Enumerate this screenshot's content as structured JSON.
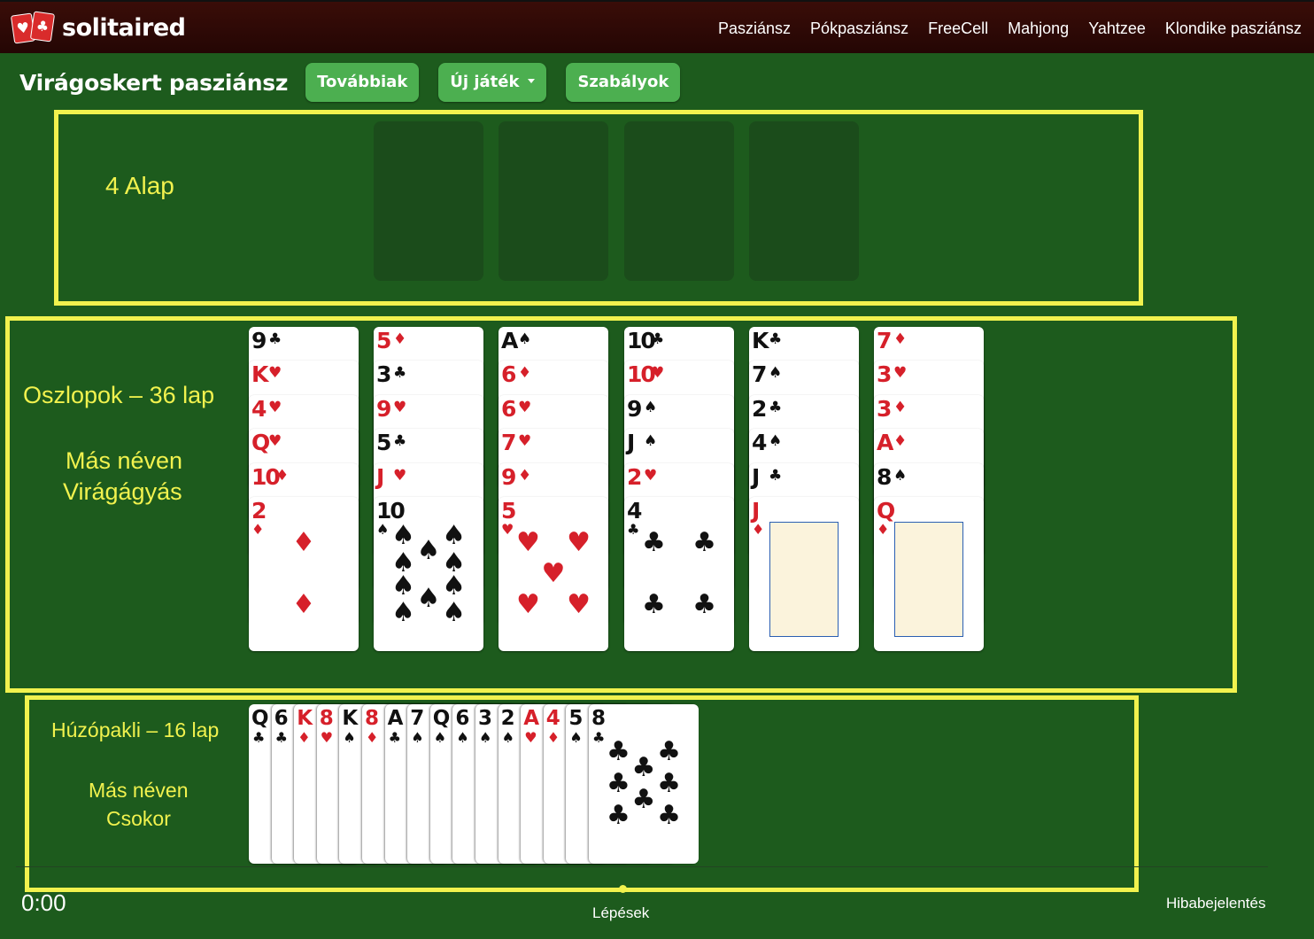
{
  "header": {
    "brand": "solitaired",
    "nav": [
      "Pasziánsz",
      "Pókpasziánsz",
      "FreeCell",
      "Mahjong",
      "Yahtzee",
      "Klondike pasziánsz"
    ]
  },
  "toolbar": {
    "title": "Virágoskert pasziánsz",
    "more_label": "Továbbiak",
    "new_game_label": "Új játék",
    "rules_label": "Szabályok"
  },
  "annotations": {
    "foundations": "4 Alap",
    "columns_title": "Oszlopok – 36 lap",
    "columns_alias_1": "Más néven",
    "columns_alias_2": "Virágágyás",
    "stock_title": "Húzópakli – 16 lap",
    "stock_alias_1": "Más néven",
    "stock_alias_2": "Csokor",
    "highlight_color": "#f1f24e"
  },
  "suits": {
    "S": "♠",
    "H": "♥",
    "D": "♦",
    "C": "♣"
  },
  "foundations": {
    "count": 4
  },
  "tableau": [
    [
      {
        "r": "9",
        "s": "C"
      },
      {
        "r": "K",
        "s": "H"
      },
      {
        "r": "4",
        "s": "H"
      },
      {
        "r": "Q",
        "s": "H"
      },
      {
        "r": "10",
        "s": "D"
      },
      {
        "r": "2",
        "s": "D"
      }
    ],
    [
      {
        "r": "5",
        "s": "D"
      },
      {
        "r": "3",
        "s": "C"
      },
      {
        "r": "9",
        "s": "H"
      },
      {
        "r": "5",
        "s": "C"
      },
      {
        "r": "J",
        "s": "H"
      },
      {
        "r": "10",
        "s": "S"
      }
    ],
    [
      {
        "r": "A",
        "s": "S"
      },
      {
        "r": "6",
        "s": "D"
      },
      {
        "r": "6",
        "s": "H"
      },
      {
        "r": "7",
        "s": "H"
      },
      {
        "r": "9",
        "s": "D"
      },
      {
        "r": "5",
        "s": "H"
      }
    ],
    [
      {
        "r": "10",
        "s": "C"
      },
      {
        "r": "10",
        "s": "H"
      },
      {
        "r": "9",
        "s": "S"
      },
      {
        "r": "J",
        "s": "S"
      },
      {
        "r": "2",
        "s": "H"
      },
      {
        "r": "4",
        "s": "C"
      }
    ],
    [
      {
        "r": "K",
        "s": "C"
      },
      {
        "r": "7",
        "s": "S"
      },
      {
        "r": "2",
        "s": "C"
      },
      {
        "r": "4",
        "s": "S"
      },
      {
        "r": "J",
        "s": "C"
      },
      {
        "r": "J",
        "s": "D"
      }
    ],
    [
      {
        "r": "7",
        "s": "D"
      },
      {
        "r": "3",
        "s": "H"
      },
      {
        "r": "3",
        "s": "D"
      },
      {
        "r": "A",
        "s": "D"
      },
      {
        "r": "8",
        "s": "S"
      },
      {
        "r": "Q",
        "s": "D"
      }
    ]
  ],
  "stock": [
    {
      "r": "Q",
      "s": "C"
    },
    {
      "r": "6",
      "s": "C"
    },
    {
      "r": "K",
      "s": "D"
    },
    {
      "r": "8",
      "s": "H"
    },
    {
      "r": "K",
      "s": "S"
    },
    {
      "r": "8",
      "s": "D"
    },
    {
      "r": "A",
      "s": "C"
    },
    {
      "r": "7",
      "s": "S"
    },
    {
      "r": "Q",
      "s": "S"
    },
    {
      "r": "6",
      "s": "S"
    },
    {
      "r": "3",
      "s": "S"
    },
    {
      "r": "2",
      "s": "S"
    },
    {
      "r": "A",
      "s": "H"
    },
    {
      "r": "4",
      "s": "D"
    },
    {
      "r": "5",
      "s": "S"
    },
    {
      "r": "8",
      "s": "C"
    }
  ],
  "footer": {
    "timer": "0:00",
    "moves_label": "Lépések",
    "report_label": "Hibabejelentés"
  }
}
